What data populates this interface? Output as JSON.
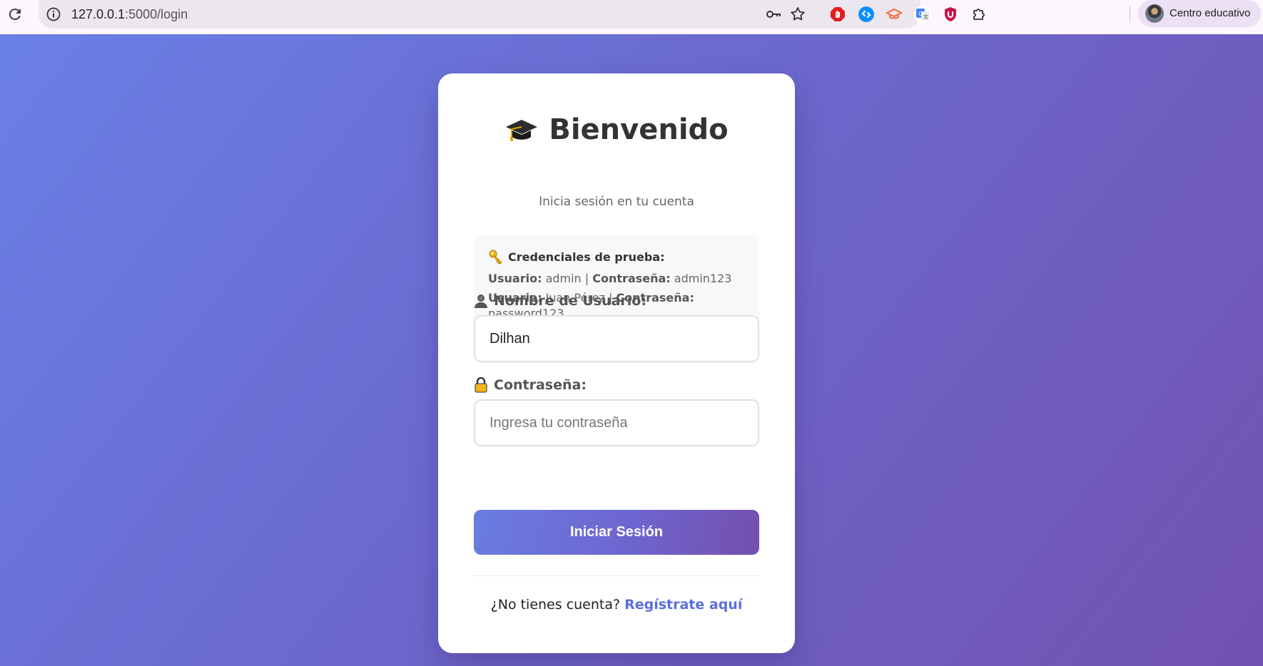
{
  "browser": {
    "url_host": "127.0.0.1",
    "url_path": ":5000/login",
    "profile_name": "Centro educativo",
    "icons": [
      "reload-icon",
      "site-info-icon",
      "password-key-icon",
      "bookmark-star-icon",
      "adblock-extension-icon",
      "shazam-extension-icon",
      "graduation-extension-icon",
      "translate-extension-icon",
      "ublock-extension-icon",
      "extensions-puzzle-icon"
    ]
  },
  "login": {
    "title": "Bienvenido",
    "subtitle": "Inicia sesión en tu cuenta",
    "credentials": {
      "heading": "Credenciales de prueba:",
      "user_label": "Usuario:",
      "pass_label": "Contraseña:",
      "separator": "|",
      "accounts": [
        {
          "user": "admin",
          "password": "admin123"
        },
        {
          "user": "Juan Pérez",
          "password": "password123"
        }
      ]
    },
    "username": {
      "label": "Nombre de Usuario:",
      "value": "Dilhan"
    },
    "password": {
      "label": "Contraseña:",
      "placeholder": "Ingresa tu contraseña"
    },
    "submit_label": "Iniciar Sesión",
    "footer": {
      "text": "¿No tienes cuenta?",
      "link": "Regístrate aquí"
    }
  },
  "colors": {
    "gradient_start": "#6a80e6",
    "gradient_end": "#7252b0",
    "link": "#5b6fd9"
  }
}
